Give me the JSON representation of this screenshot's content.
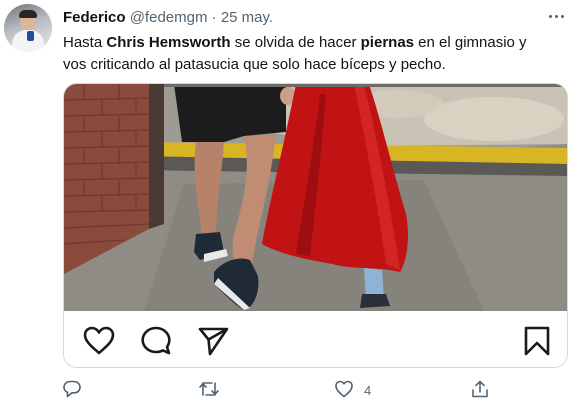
{
  "tweet": {
    "author_name": "Federico",
    "handle": "@fedemgm",
    "separator": "·",
    "date": "25 may.",
    "text_parts": {
      "p1": "Hasta ",
      "b1": "Chris Hemsworth",
      "p2": " se olvida de hacer ",
      "b2": "piernas",
      "p3": " en el gimnasio y vos criticando al patasucia que solo hace bíceps y pecho."
    }
  },
  "media_actions": {
    "icons": [
      "heart-icon",
      "comment-icon",
      "send-icon",
      "bookmark-icon"
    ]
  },
  "footer": {
    "icons": [
      "reply-icon",
      "retweet-icon",
      "like-icon",
      "share-icon"
    ],
    "like_count": "4"
  }
}
